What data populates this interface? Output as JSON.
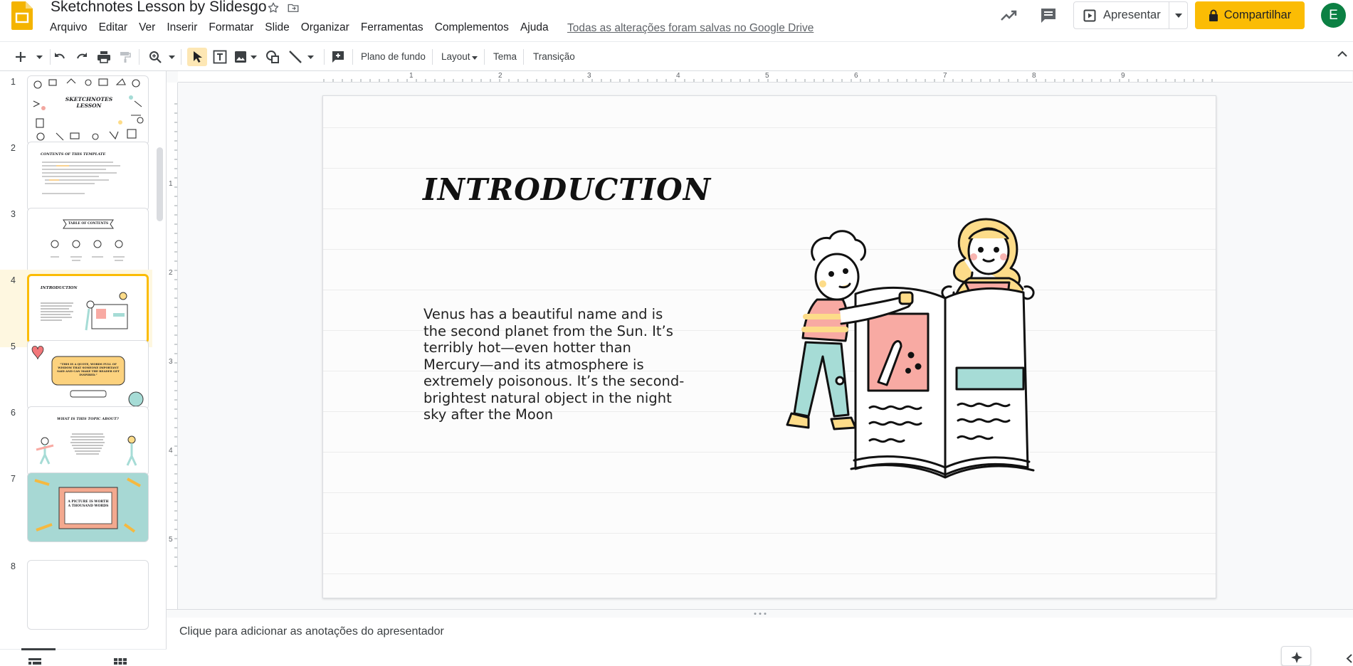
{
  "header": {
    "doc_title": "Sketchnotes Lesson by Slidesgo",
    "menu": [
      "Arquivo",
      "Editar",
      "Ver",
      "Inserir",
      "Formatar",
      "Slide",
      "Organizar",
      "Ferramentas",
      "Complementos",
      "Ajuda"
    ],
    "saved_status": "Todas as alterações foram salvas no Google Drive",
    "present_label": "Apresentar",
    "share_label": "Compartilhar",
    "avatar_initial": "E"
  },
  "toolbar": {
    "background_label": "Plano de fundo",
    "layout_label": "Layout",
    "theme_label": "Tema",
    "transition_label": "Transição"
  },
  "filmstrip": {
    "slides": [
      {
        "number": "1",
        "caption": "SKETCHNOTES LESSON"
      },
      {
        "number": "2",
        "caption": "CONTENTS OF THIS TEMPLATE"
      },
      {
        "number": "3",
        "caption": "TABLE OF CONTENTS"
      },
      {
        "number": "4",
        "caption": "INTRODUCTION",
        "selected": true
      },
      {
        "number": "5",
        "caption": "“THIS IS A QUOTE, WORDS FULL OF WISDOM THAT SOMEONE IMPORTANT SAID AND CAN MAKE THE READER GET INSPIRED.”"
      },
      {
        "number": "6",
        "caption": "WHAT IS THIS TOPIC ABOUT?"
      },
      {
        "number": "7",
        "caption": "A PICTURE IS WORTH A THOUSAND WORDS"
      },
      {
        "number": "8",
        "caption": ""
      }
    ]
  },
  "ruler": {
    "horizontal": [
      "1",
      "2",
      "3",
      "4",
      "5",
      "6",
      "7",
      "8",
      "9"
    ],
    "vertical": [
      "1",
      "2",
      "3",
      "4",
      "5"
    ]
  },
  "slide": {
    "title": "INTRODUCTION",
    "body": "Venus has a beautiful name and is the second planet from the Sun. It’s terribly hot—even hotter than Mercury—and its atmosphere is extremely poisonous. It’s the second-brightest natural object in the night sky after the Moon"
  },
  "notes": {
    "placeholder": "Clique para adicionar as anotações do apresentador"
  },
  "colors": {
    "accent": "#fbbc04",
    "selection_bg": "#fef7e0",
    "illus_pink": "#f8aaa3",
    "illus_teal": "#a6dcd6",
    "illus_yellow": "#fddc89"
  }
}
